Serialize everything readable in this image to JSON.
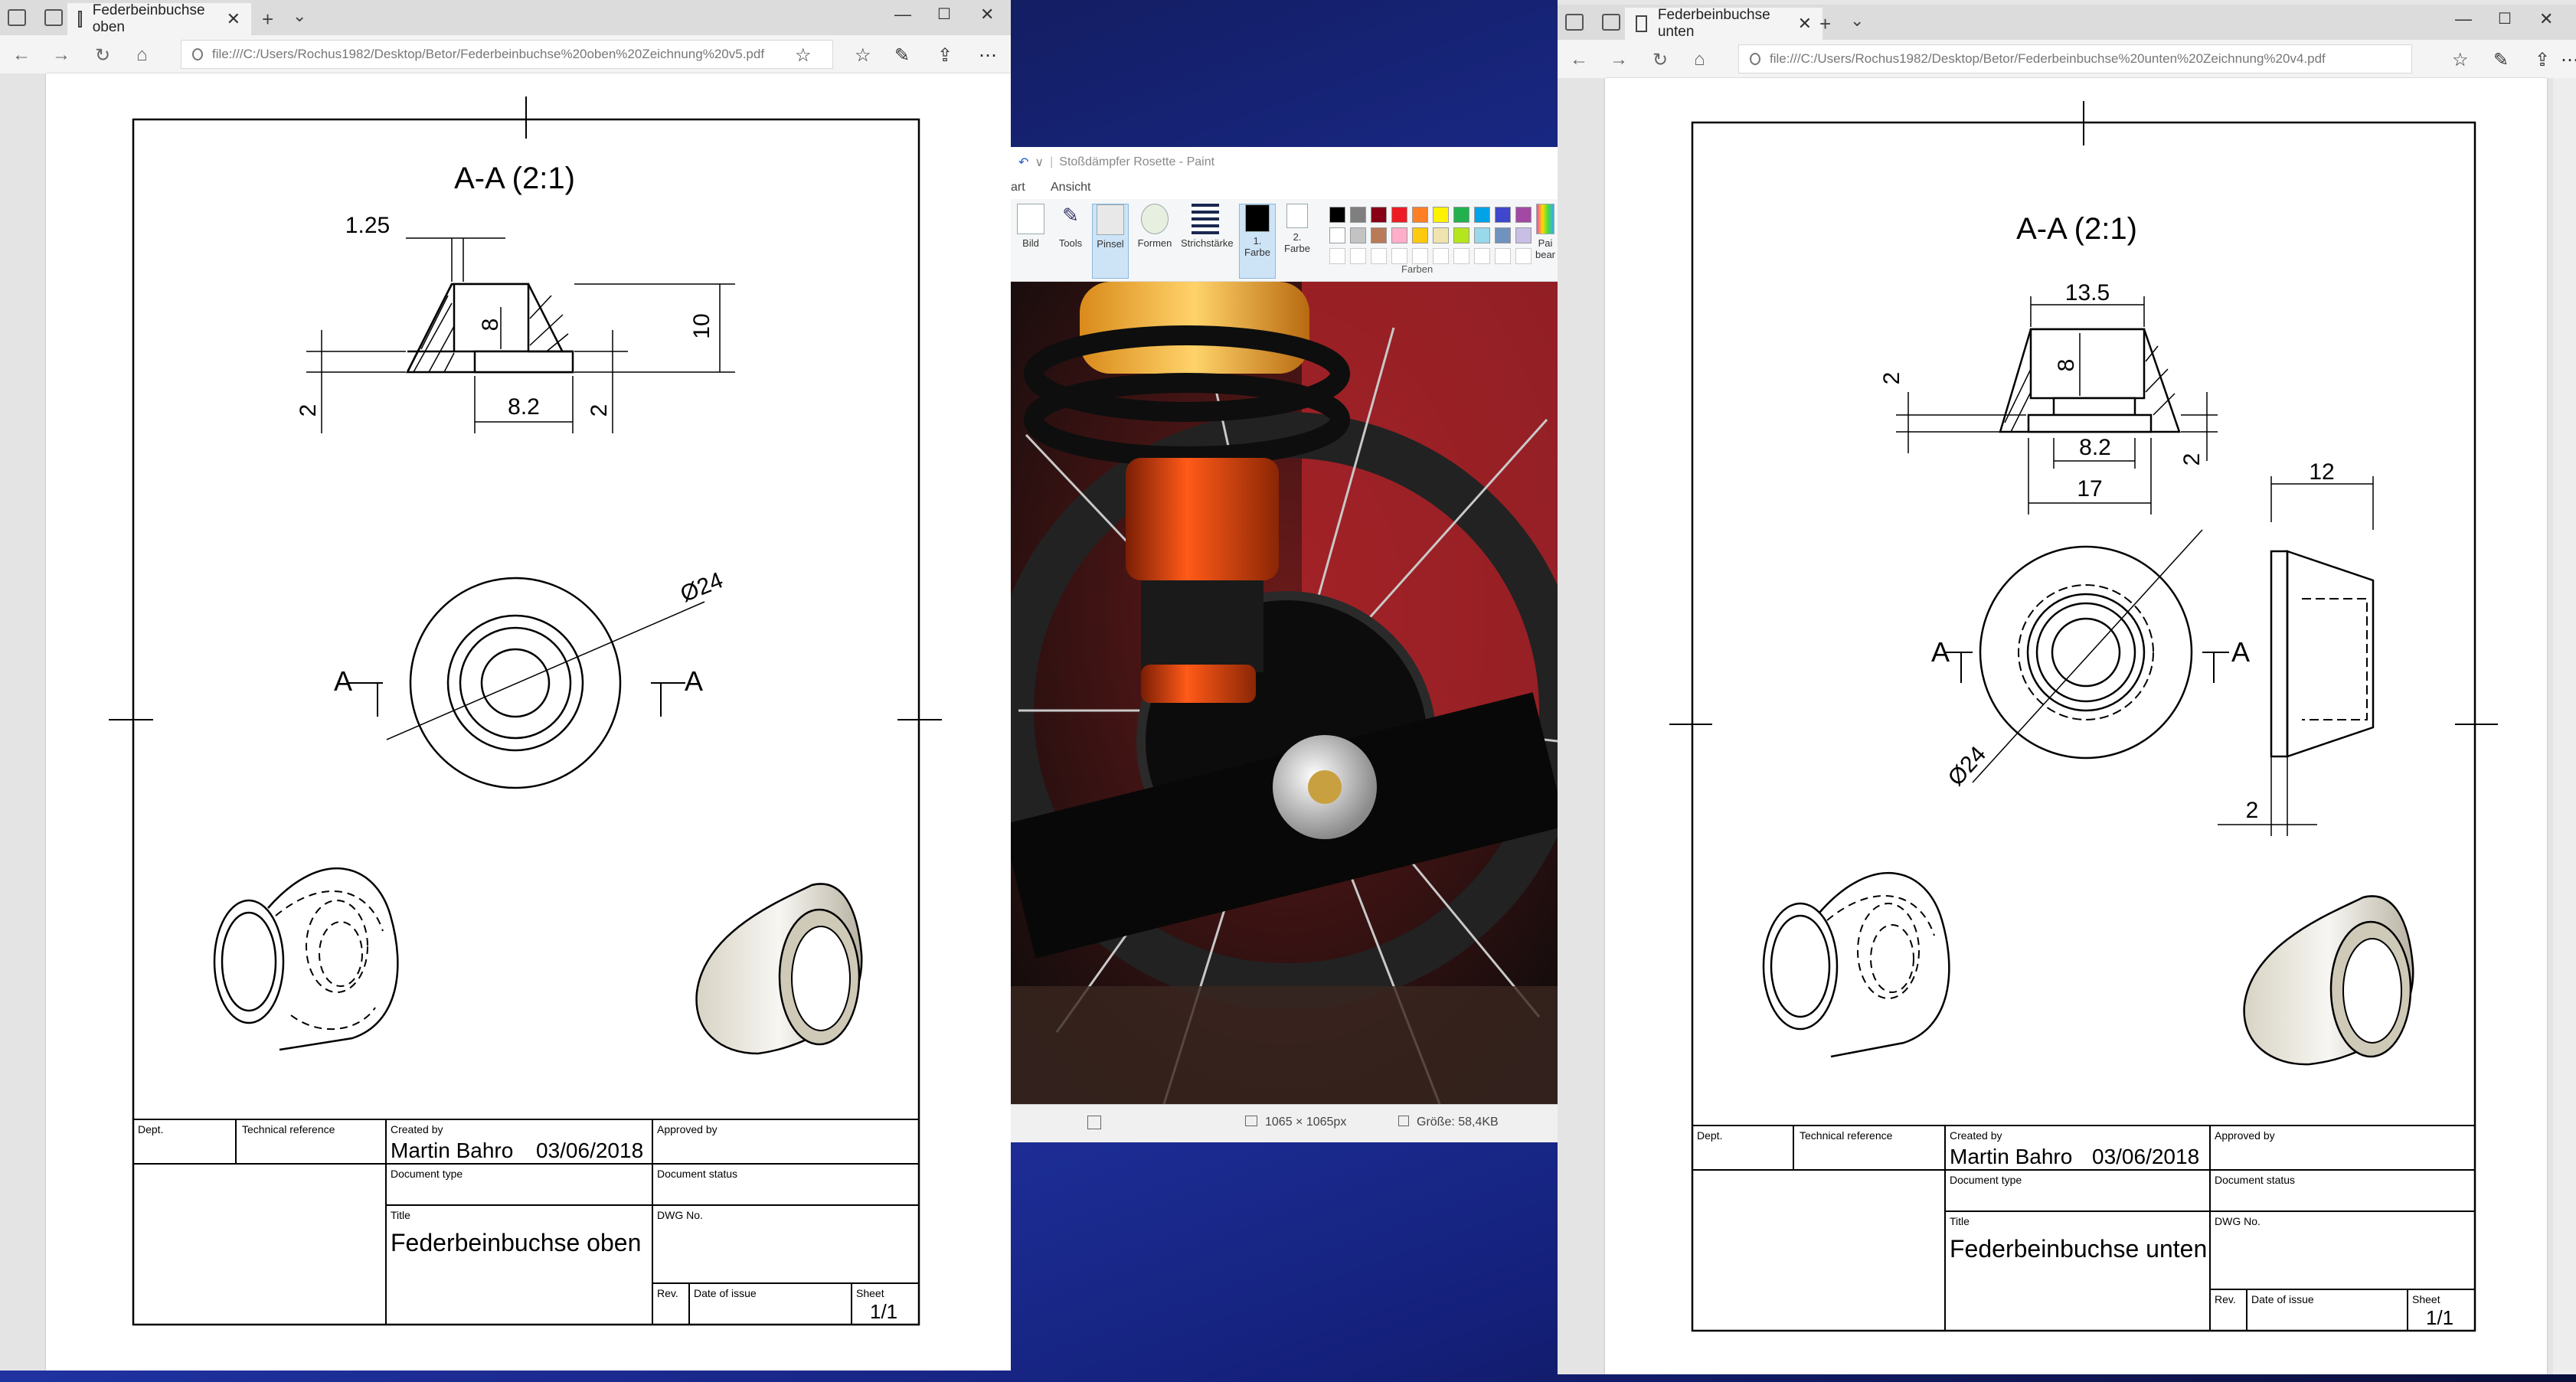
{
  "left_window": {
    "tab_title": "Federbeinbuchse oben",
    "address": "file:///C:/Users/Rochus1982/Desktop/Betor/Federbeinbuchse%20oben%20Zeichnung%20v5.pdf",
    "drawing": {
      "section_title": "A-A (2:1)",
      "dim_1": "1.25",
      "dim_2": "8",
      "dim_3": "10",
      "dim_4": "8.2",
      "dim_5": "2",
      "dim_6": "2",
      "dim_diameter": "Ø24",
      "section_mark_left": "A",
      "section_mark_right": "A"
    },
    "title_block": {
      "dept_label": "Dept.",
      "techref_label": "Technical reference",
      "created_label": "Created by",
      "created_value": "Martin Bahro",
      "date_value": "03/06/2018",
      "approved_label": "Approved by",
      "doctype_label": "Document type",
      "docstatus_label": "Document status",
      "title_label": "Title",
      "title_value": "Federbeinbuchse oben",
      "dwg_label": "DWG No.",
      "rev_label": "Rev.",
      "issue_label": "Date of issue",
      "sheet_label": "Sheet",
      "sheet_value": "1/1"
    }
  },
  "right_window": {
    "tab_title": "Federbeinbuchse unten",
    "address": "file:///C:/Users/Rochus1982/Desktop/Betor/Federbeinbuchse%20unten%20Zeichnung%20v4.pdf",
    "drawing": {
      "section_title": "A-A (2:1)",
      "dim_1": "13.5",
      "dim_2": "8",
      "dim_3": "2",
      "dim_4": "8.2",
      "dim_5": "2",
      "dim_6": "17",
      "dim_7": "12",
      "dim_8": "2",
      "dim_diameter": "Ø24",
      "section_mark_left": "A",
      "section_mark_right": "A"
    },
    "title_block": {
      "dept_label": "Dept.",
      "techref_label": "Technical reference",
      "created_label": "Created by",
      "created_value": "Martin Bahro",
      "date_value": "03/06/2018",
      "approved_label": "Approved by",
      "doctype_label": "Document type",
      "docstatus_label": "Document status",
      "title_label": "Title",
      "title_value": "Federbeinbuchse unten",
      "dwg_label": "DWG No.",
      "rev_label": "Rev.",
      "issue_label": "Date of issue",
      "sheet_label": "Sheet",
      "sheet_value": "1/1"
    }
  },
  "paint": {
    "title": "Stoßdämpfer Rosette - Paint",
    "menu_start": "art",
    "menu_view": "Ansicht",
    "tools": {
      "bild": "Bild",
      "tools": "Tools",
      "pinsel": "Pinsel",
      "formen": "Formen",
      "strich": "Strichstärke",
      "farbe1_a": "1.",
      "farbe1_b": "Farbe",
      "farbe2_a": "2.",
      "farbe2_b": "Farbe",
      "farben_group": "Farben",
      "paint3d_a": "Pai",
      "paint3d_b": "bear"
    },
    "status_dims": "1065 × 1065px",
    "status_size": "Größe: 58,4KB",
    "palette": [
      "#000000",
      "#7f7f7f",
      "#880015",
      "#ed1c24",
      "#ff7f27",
      "#fff200",
      "#22b14c",
      "#00a2e8",
      "#3f48cc",
      "#a349a4",
      "#ffffff",
      "#c3c3c3",
      "#b97a57",
      "#ffaec9",
      "#ffc90e",
      "#efe4b0",
      "#b5e61d",
      "#99d9ea",
      "#7092be",
      "#c8bfe7"
    ]
  },
  "icons": [
    "tab-actions-icon",
    "set-aside-icon",
    "document-icon",
    "close-icon",
    "new-tab-icon",
    "tab-dropdown-icon",
    "minimize-icon",
    "maximize-icon",
    "window-close-icon",
    "back-icon",
    "forward-icon",
    "refresh-icon",
    "home-icon",
    "info-icon",
    "favorite-icon",
    "favorites-list-icon",
    "pen-icon",
    "share-icon",
    "more-icon"
  ]
}
